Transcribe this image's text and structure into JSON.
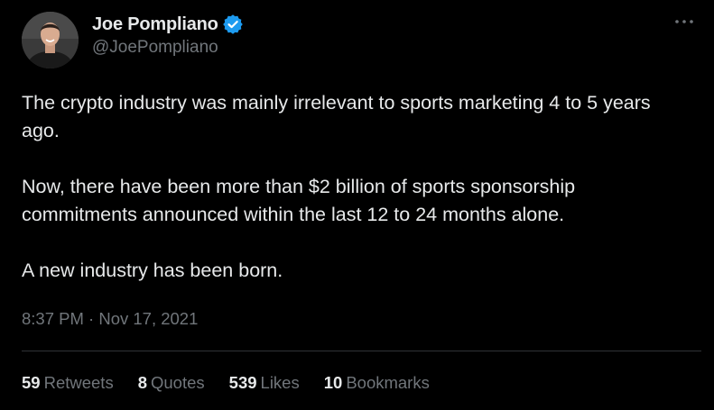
{
  "author": {
    "display_name": "Joe Pompliano",
    "handle": "@JoePompliano",
    "verified_icon": "verified-badge-icon",
    "avatar_icon": "avatar-photo"
  },
  "menu": {
    "icon": "more-options-icon"
  },
  "tweet": {
    "paragraphs": [
      "The crypto industry was mainly irrelevant to sports marketing 4 to 5 years ago.",
      "Now, there have been more than $2 billion of sports sponsorship commitments announced within the last 12 to 24 months alone.",
      "A new industry has been born."
    ],
    "timestamp": "8:37 PM · Nov 17, 2021"
  },
  "stats": [
    {
      "count": "59",
      "label": "Retweets"
    },
    {
      "count": "8",
      "label": "Quotes"
    },
    {
      "count": "539",
      "label": "Likes"
    },
    {
      "count": "10",
      "label": "Bookmarks"
    }
  ],
  "colors": {
    "background": "#000000",
    "text_primary": "#e7e9ea",
    "text_secondary": "#71767b",
    "verified_blue": "#1d9bf0",
    "divider": "#2f3336"
  }
}
